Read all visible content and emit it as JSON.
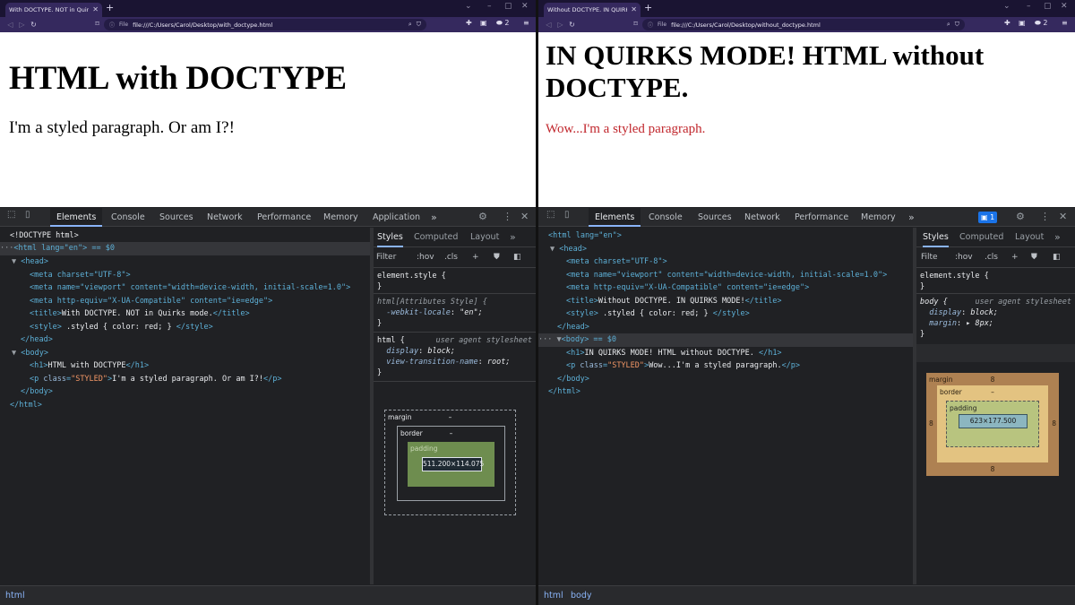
{
  "left": {
    "tab_title": "With DOCTYPE. NOT in Quirks m",
    "url_chip": "File",
    "url": "file:///C:/Users/Carol/Desktop/with_doctype.html",
    "brave_count": "2",
    "h1": "HTML with DOCTYPE",
    "p": "I'm a styled paragraph. Or am I?!",
    "devtools_tabs": [
      "Elements",
      "Console",
      "Sources",
      "Network",
      "Performance",
      "Memory",
      "Application"
    ],
    "dom": {
      "doctype": "<!DOCTYPE html>",
      "html_open": "<html lang=\"en\"> == $0",
      "head": "<head>",
      "meta_charset": "<meta charset=\"UTF-8\">",
      "meta_viewport": "<meta name=\"viewport\" content=\"width=device-width, initial-scale=1.0\">",
      "meta_ie": "<meta http-equiv=\"X-UA-Compatible\" content=\"ie=edge\">",
      "title_text": "With DOCTYPE. NOT in Quirks mode.",
      "style_text": ".styled { color: red; }",
      "body": "<body>",
      "h1_text": "HTML with DOCTYPE",
      "p_text": "I'm a styled paragraph. Or am I?!"
    },
    "styles_tabs": [
      "Styles",
      "Computed",
      "Layout"
    ],
    "filter_placeholder": "Filter",
    "hov": ":hov",
    "cls": ".cls",
    "rules": {
      "element_style": "element.style {",
      "attr_selector": "html[Attributes Style] {",
      "attr_prop": "-webkit-locale",
      "attr_val": "\"en\";",
      "html_selector": "html {",
      "ua": "user agent stylesheet",
      "p1": "display",
      "v1": "block;",
      "p2": "view-transition-name",
      "v2": "root;"
    },
    "boxmodel": {
      "margin_label": "margin",
      "border_label": "border",
      "padding_label": "padding",
      "dash": "–",
      "content": "511.200×114.075"
    },
    "crumbs": [
      "html"
    ]
  },
  "right": {
    "tab_title": "Without DOCTYPE. IN QUIRKS M",
    "url_chip": "File",
    "url": "file:///C:/Users/Carol/Desktop/without_doctype.html",
    "brave_count": "2",
    "h1": "IN QUIRKS MODE! HTML without DOCTYPE.",
    "p": "Wow...I'm a styled paragraph.",
    "devtools_tabs": [
      "Elements",
      "Console",
      "Sources",
      "Network",
      "Performance",
      "Memory"
    ],
    "issues_count": "1",
    "dom": {
      "html_open": "<html lang=\"en\">",
      "head": "<head>",
      "meta_charset": "<meta charset=\"UTF-8\">",
      "meta_viewport": "<meta name=\"viewport\" content=\"width=device-width, initial-scale=1.0\">",
      "meta_ie": "<meta http-equiv=\"X-UA-Compatible\" content=\"ie=edge\">",
      "title_text": "Without DOCTYPE. IN QUIRKS MODE!",
      "style_text": ".styled { color: red; }",
      "body_sel": "<body> == $0",
      "h1_text": "IN QUIRKS MODE! HTML without DOCTYPE.",
      "p_text": "Wow...I'm a styled paragraph."
    },
    "styles_tabs": [
      "Styles",
      "Computed",
      "Layout"
    ],
    "filter_placeholder": "Filte",
    "hov": ":hov",
    "cls": ".cls",
    "rules": {
      "element_style": "element.style {",
      "body_selector": "body {",
      "ua": "user agent stylesheet",
      "p1": "display",
      "v1": "block;",
      "p2": "margin",
      "v2": "8px;"
    },
    "boxmodel": {
      "margin_label": "margin",
      "border_label": "border",
      "padding_label": "padding",
      "dash": "–",
      "margin_val": "8",
      "content": "623×177.500"
    },
    "crumbs": [
      "html",
      "body"
    ]
  },
  "colors": {
    "browser_frame": "#35295e",
    "devtools_bg": "#202124",
    "quirks_text": "#c1272d",
    "tag": "#5db0d7",
    "attr_value": "#f29766",
    "margin_box": "#ae8152",
    "border_box": "#e3c381",
    "padding_box": "#b8c47f",
    "content_box": "#8cb6c0"
  },
  "icons": [
    "close-icon",
    "plus-icon",
    "back-icon",
    "forward-icon",
    "reload-icon",
    "bookmark-icon",
    "brave-shield-icon",
    "extensions-icon",
    "menu-icon",
    "inspect-icon",
    "device-toggle-icon",
    "gear-icon",
    "kebab-icon"
  ]
}
